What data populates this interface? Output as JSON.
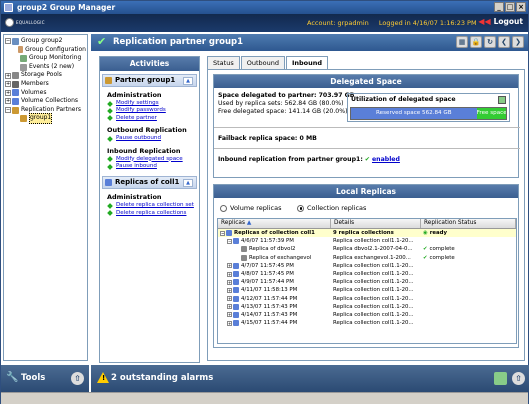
{
  "window": {
    "title": "group2 Group Manager",
    "min": "_",
    "max": "□",
    "close": "×"
  },
  "header": {
    "logo": "EQUALLOGIC",
    "account": "Account: grpadmin",
    "login": "Logged in 4/16/07 1:16:23 PM",
    "logout": "Logout"
  },
  "tree": [
    {
      "label": "Group group2",
      "indent": 0,
      "pm": "−",
      "color": "#6a8fc0"
    },
    {
      "label": "Group Configuration",
      "indent": 1,
      "pm": "",
      "color": "#c96"
    },
    {
      "label": "Group Monitoring",
      "indent": 1,
      "pm": "",
      "color": "#7a7"
    },
    {
      "label": "Events (2 new)",
      "indent": 1,
      "pm": "",
      "color": "#999"
    },
    {
      "label": "Storage Pools",
      "indent": 0,
      "pm": "+",
      "color": "#888"
    },
    {
      "label": "Members",
      "indent": 0,
      "pm": "+",
      "color": "#666"
    },
    {
      "label": "Volumes",
      "indent": 0,
      "pm": "+",
      "color": "#5a7fd8"
    },
    {
      "label": "Volume Collections",
      "indent": 0,
      "pm": "+",
      "color": "#5a7fd8"
    },
    {
      "label": "Replication Partners",
      "indent": 0,
      "pm": "−",
      "color": "#c93"
    },
    {
      "label": "group1",
      "indent": 1,
      "pm": "",
      "color": "#c93",
      "selected": true
    }
  ],
  "tools": {
    "label": "Tools"
  },
  "main": {
    "title": "Replication partner group1"
  },
  "activities": {
    "title": "Activities",
    "group1": {
      "label": "Partner group1",
      "sections": [
        {
          "heading": "Administration",
          "links": [
            "Modify settings",
            "Modify passwords",
            "Delete partner"
          ]
        },
        {
          "heading": "Outbound Replication",
          "links": [
            "Pause outbound"
          ]
        },
        {
          "heading": "Inbound Replication",
          "links": [
            "Modify delegated space",
            "Pause inbound"
          ]
        }
      ]
    },
    "group2": {
      "label": "Replicas of coll1",
      "sections": [
        {
          "heading": "Administration",
          "links": [
            "Delete replica collection set",
            "Delete replica collections"
          ]
        }
      ]
    }
  },
  "tabs": [
    "Status",
    "Outbound",
    "Inbound"
  ],
  "delegated": {
    "title": "Delegated Space",
    "space_label": "Space delegated to partner:",
    "space_value": "703.97 GB",
    "used": "Used by replica sets: 562.84 GB (80.0%)",
    "free": "Free delegated space: 141.14 GB (20.0%)",
    "util_title": "Utilization of delegated space",
    "reserved_label": "Reserved space 562.84 GB",
    "free_label": "Free space",
    "reserved_fraction": 0.8,
    "fallback": "Failback replica space: 0 MB",
    "inbound_label": "Inbound replication from partner group1:",
    "inbound_value": "enabled"
  },
  "local": {
    "title": "Local Replicas",
    "radio1": "Volume replicas",
    "radio2": "Collection replicas",
    "columns": [
      "Replicas",
      "Details",
      "Replication Status"
    ],
    "rows": [
      {
        "c1": "Replicas of collection coll1",
        "c2": "9 replica collections",
        "c3": "ready",
        "indent": 0,
        "pm": "−",
        "sel": true,
        "ok": true
      },
      {
        "c1": "4/6/07 11:57:39 PM",
        "c2": "Replica collection coll1.1-20...",
        "c3": "",
        "indent": 1,
        "pm": "−"
      },
      {
        "c1": "Replica of dbvol2",
        "c2": "Replica dbvol2.1-2007-04-0...",
        "c3": "complete",
        "indent": 2,
        "pm": "",
        "ok": true
      },
      {
        "c1": "Replica of exchangevol",
        "c2": "Replica exchangevol.1-200...",
        "c3": "complete",
        "indent": 2,
        "pm": "",
        "ok": true
      },
      {
        "c1": "4/7/07 11:57:45 PM",
        "c2": "Replica collection coll1.1-20...",
        "c3": "",
        "indent": 1,
        "pm": "+"
      },
      {
        "c1": "4/8/07 11:57:45 PM",
        "c2": "Replica collection coll1.1-20...",
        "c3": "",
        "indent": 1,
        "pm": "+"
      },
      {
        "c1": "4/9/07 11:57:44 PM",
        "c2": "Replica collection coll1.1-20...",
        "c3": "",
        "indent": 1,
        "pm": "+"
      },
      {
        "c1": "4/11/07 11:58:13 PM",
        "c2": "Replica collection coll1.1-20...",
        "c3": "",
        "indent": 1,
        "pm": "+"
      },
      {
        "c1": "4/12/07 11:57:44 PM",
        "c2": "Replica collection coll1.1-20...",
        "c3": "",
        "indent": 1,
        "pm": "+"
      },
      {
        "c1": "4/13/07 11:57:43 PM",
        "c2": "Replica collection coll1.1-20...",
        "c3": "",
        "indent": 1,
        "pm": "+"
      },
      {
        "c1": "4/14/07 11:57:43 PM",
        "c2": "Replica collection coll1.1-20...",
        "c3": "",
        "indent": 1,
        "pm": "+"
      },
      {
        "c1": "4/15/07 11:57:44 PM",
        "c2": "Replica collection coll1.1-20...",
        "c3": "",
        "indent": 1,
        "pm": "+"
      }
    ]
  },
  "status": {
    "alarms": "2 outstanding alarms"
  }
}
